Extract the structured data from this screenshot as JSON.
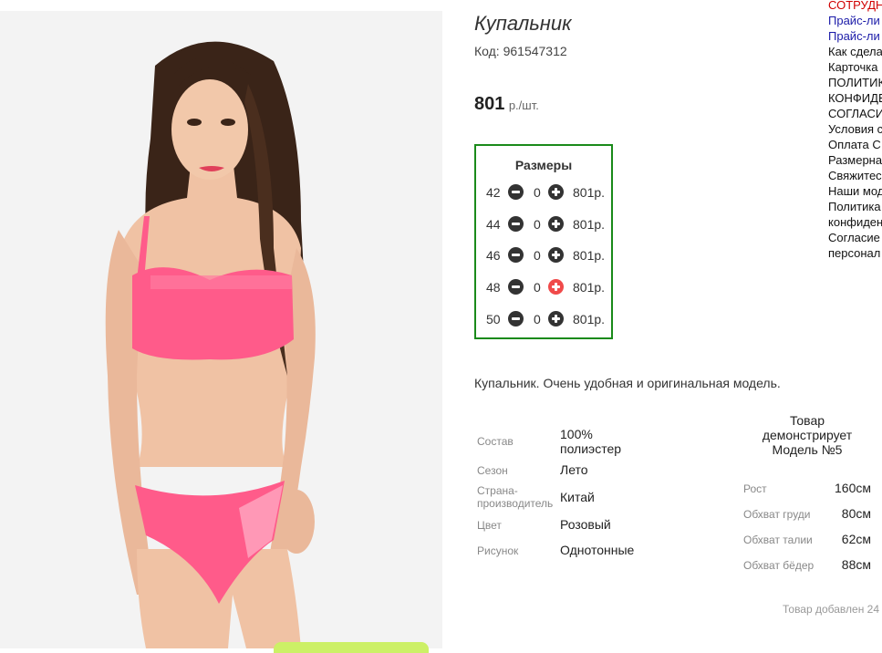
{
  "product": {
    "title": "Купальник",
    "code": "Код: 961547312",
    "price": "801",
    "price_unit": "р./шт.",
    "sizes_title": "Размеры",
    "sizes": [
      {
        "size": "42",
        "qty": "0",
        "price": "801р."
      },
      {
        "size": "44",
        "qty": "0",
        "price": "801р."
      },
      {
        "size": "46",
        "qty": "0",
        "price": "801р."
      },
      {
        "size": "48",
        "qty": "0",
        "price": "801р."
      },
      {
        "size": "50",
        "qty": "0",
        "price": "801р."
      }
    ],
    "description": "Купальник. Очень удобная и оригинальная модель.",
    "attributes": [
      {
        "label": "Состав",
        "value": "100% полиэстер"
      },
      {
        "label": "Сезон",
        "value": "Лето"
      },
      {
        "label": "Страна-производитель",
        "value": "Китай"
      },
      {
        "label": "Цвет",
        "value": "Розовый"
      },
      {
        "label": "Рисунок",
        "value": "Однотонные"
      }
    ],
    "model": {
      "heading": "Товар демонстрирует Модель №5",
      "measurements": [
        {
          "label": "Рост",
          "value": "160см"
        },
        {
          "label": "Обхват груди",
          "value": "80см"
        },
        {
          "label": "Обхват талии",
          "value": "62см"
        },
        {
          "label": "Обхват бёдер",
          "value": "88см"
        }
      ]
    },
    "added": "Товар добавлен 24"
  },
  "side_menu": [
    {
      "label": "СОТРУДН",
      "color": "red"
    },
    {
      "label": "Прайс-ли",
      "color": "blue"
    },
    {
      "label": "Прайс-ли",
      "color": "blue"
    },
    {
      "label": "Как сдела",
      "color": "black"
    },
    {
      "label": "Карточка",
      "color": "black"
    },
    {
      "label": "ПОЛИТИК",
      "color": "black"
    },
    {
      "label": "КОНФИДЕ",
      "color": "black"
    },
    {
      "label": "СОГЛАСИ",
      "color": "black"
    },
    {
      "label": "Условия с",
      "color": "black"
    },
    {
      "label": "Оплата С",
      "color": "black"
    },
    {
      "label": "Размерна",
      "color": "black"
    },
    {
      "label": "Свяжитес",
      "color": "black"
    },
    {
      "label": "Наши мод",
      "color": "black"
    },
    {
      "label": "Политика",
      "color": "black"
    },
    {
      "label": "конфиден",
      "color": "black"
    },
    {
      "label": "Согласие",
      "color": "black"
    },
    {
      "label": "персонал",
      "color": "black"
    }
  ],
  "colors": {
    "sizes_border": "#1a8a1a",
    "active_plus": "#f04a4a",
    "swimsuit": "#ff5b8a"
  }
}
